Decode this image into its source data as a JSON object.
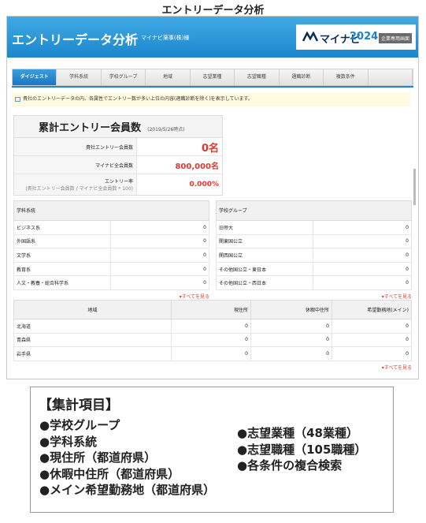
{
  "page_title": "エントリーデータ分析",
  "header": {
    "title": "エントリーデータ分析",
    "company": "マイナビ薬事(株)様",
    "brand_name": "マイナビ",
    "brand_year": "2024",
    "brand_badge": "企業専用画面"
  },
  "tabs": [
    "ダイジェスト",
    "学科系統",
    "学校グループ",
    "地域",
    "志望業種",
    "志望職種",
    "通職診断",
    "複数条件",
    ""
  ],
  "active_tab": "ダイジェスト",
  "notice": "貴社のエントリーデータの内、各属性でエントリー数が多い上位の内容(適職診断を除く)を表示しています。",
  "summary": {
    "title": "累計エントリー会員数",
    "date": "(2019/5/26時点)",
    "rows": [
      {
        "label": "貴社エントリー会員数",
        "value": "0名"
      },
      {
        "label": "マイナビ全会員数",
        "value": "800,000名"
      },
      {
        "label": "エントリー率",
        "sub": "(貴社エントリー会員数 / マイナビ全会員数 * 100)",
        "value": "0.000%"
      }
    ]
  },
  "faculty": {
    "header": "学科系統",
    "rows": [
      {
        "name": "ビジネス系",
        "count": "0"
      },
      {
        "name": "外国語系",
        "count": "0"
      },
      {
        "name": "文学系",
        "count": "0"
      },
      {
        "name": "教育系",
        "count": "0"
      },
      {
        "name": "人文・教養・総合科学系",
        "count": "0"
      }
    ],
    "more": "▾すべてを見る"
  },
  "school": {
    "header": "学校グループ",
    "rows": [
      {
        "name": "旧帝大",
        "count": "0"
      },
      {
        "name": "関東国公立",
        "count": "0"
      },
      {
        "name": "関西国公立",
        "count": "0"
      },
      {
        "name": "その他国公立・東日本",
        "count": "0"
      },
      {
        "name": "その他国公立・西日本",
        "count": "0"
      }
    ],
    "more": "▾すべてを見る"
  },
  "region": {
    "headers": [
      "地域",
      "現住所",
      "休暇中住所",
      "希望勤務地(メイン)"
    ],
    "rows": [
      [
        "北海道",
        "0",
        "0",
        "0"
      ],
      [
        "青森県",
        "0",
        "0",
        "0"
      ],
      [
        "岩手県",
        "0",
        "0",
        "0"
      ]
    ],
    "more": "▾すべてを見る"
  },
  "items": {
    "title": "【集計項目】",
    "left": [
      "●学校グループ",
      "●学科系統",
      "●現住所（都道府県）",
      "●休暇中住所（都道府県）",
      "●メイン希望勤務地（都道府県）"
    ],
    "right": [
      "●志望業種（48業種）",
      "●志望職種（105職種）",
      "●各条件の複合検索"
    ]
  }
}
